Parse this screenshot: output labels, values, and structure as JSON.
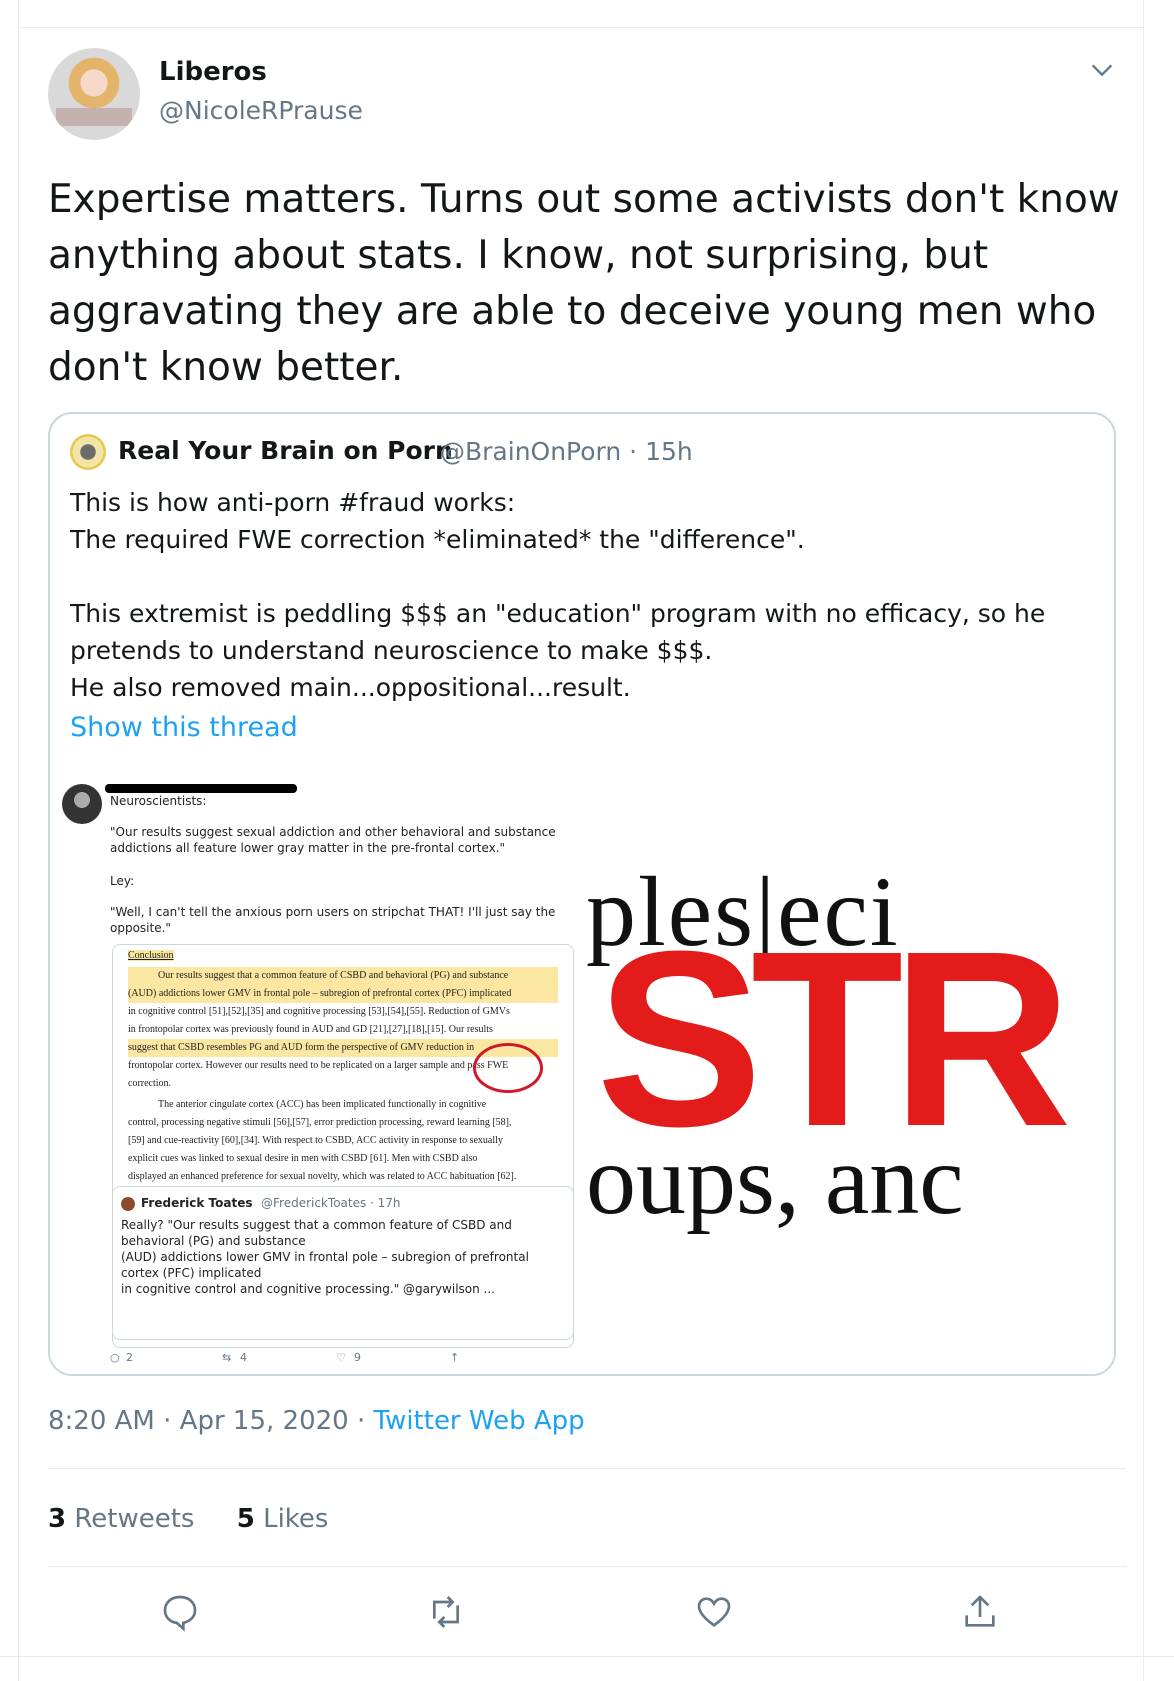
{
  "author": {
    "name": "Liberos",
    "handle": "@NicoleRPrause"
  },
  "tweet": {
    "lines": [
      "Expertise matters. Turns out some activists don't know",
      "anything about stats. I know, not surprising, but",
      "aggravating they are able to deceive young men who",
      "don't know better."
    ]
  },
  "quoted": {
    "name": "Real Your Brain on Porn",
    "handle_time": "@BrainOnPorn · 15h",
    "lines": [
      "This is how anti-porn #fraud works:",
      "The required FWE correction *eliminated* the \"difference\".",
      "",
      "This extremist is peddling $$$ an \"education\" program with no efficacy, so he",
      "pretends to understand neuroscience to make $$$.",
      "He also removed main...oppositional...result."
    ],
    "show_thread": "Show this thread",
    "screenshot": {
      "label1": "Neuroscientists:",
      "quote1": [
        "\"Our results suggest sexual addiction and other behavioral and substance",
        "addictions all feature lower gray matter in the pre-frontal cortex.\""
      ],
      "label2": "Ley:",
      "quote2": [
        "\"Well, I can't tell the anxious porn users on stripchat THAT! I'll just say the",
        "opposite.\""
      ],
      "paper_heading": "Conclusion",
      "paper_lines": [
        "Our results suggest that a common feature of CSBD and behavioral (PG) and substance",
        "(AUD) addictions lower GMV in frontal pole – subregion of prefrontal cortex (PFC) implicated",
        "in cognitive control [51],[52],[35] and cognitive processing [53],[54],[55]. Reduction of GMVs",
        "in frontopolar cortex was previously found in AUD and GD [21],[27],[18],[15]. Our results",
        "suggest that CSBD resembles PG and AUD form the perspective of GMV reduction in",
        "frontopolar cortex. However our results need to be replicated on a larger sample and pass FWE",
        "correction.",
        "The anterior cingulate cortex (ACC) has been implicated functionally in cognitive",
        "control, processing negative stimuli [56],[57], error prediction processing, reward learning [58],",
        "[59] and cue-reactivity [60],[34]. With respect to CSBD, ACC activity in response to sexually",
        "explicit cues was linked to sexual desire in men with CSBD [61]. Men with CSBD also",
        "displayed an enhanced preference for sexual novelty, which was related to ACC habituation [62]."
      ],
      "embed_name": "Frederick Toates",
      "embed_handle": "@FrederickToates · 17h",
      "embed_lines": [
        "Really? \"Our results suggest that a common feature of CSBD and",
        "behavioral (PG) and substance",
        "(AUD) addictions lower GMV in frontal pole – subregion of prefrontal",
        "cortex (PFC) implicated",
        "in cognitive control and cognitive processing.\" @garywilson ..."
      ],
      "replies": "2",
      "retweets": "4",
      "likes": "9"
    },
    "banner": {
      "top": "ples|eci",
      "middle": "STR",
      "bottom": "oups, anc"
    }
  },
  "meta": {
    "time": "8:20 AM · Apr 15, 2020 · ",
    "source": "Twitter Web App"
  },
  "counts": {
    "retweets_num": "3",
    "retweets_label": "Retweets",
    "likes_num": "5",
    "likes_label": "Likes"
  },
  "colors": {
    "accent": "#1da1f2",
    "muted": "#657786",
    "border": "#ccd6dd",
    "highlight_red": "#e31b1b"
  },
  "icons": [
    "chevron-down-icon",
    "reply-icon",
    "retweet-icon",
    "like-icon",
    "share-icon"
  ]
}
